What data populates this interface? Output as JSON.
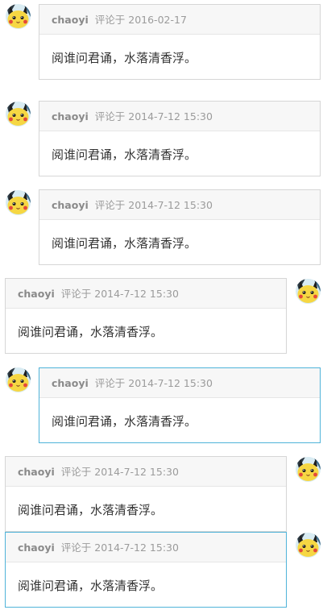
{
  "comments": [
    {
      "author": "chaoyi",
      "verb": "评论于",
      "date": "2016-02-17",
      "text": "阅谁问君诵，水落清香浮。"
    },
    {
      "author": "chaoyi",
      "verb": "评论于",
      "date": "2014-7-12 15:30",
      "text": "阅谁问君诵，水落清香浮。"
    },
    {
      "author": "chaoyi",
      "verb": "评论于",
      "date": "2014-7-12 15:30",
      "text": "阅谁问君诵，水落清香浮。"
    },
    {
      "author": "chaoyi",
      "verb": "评论于",
      "date": "2014-7-12 15:30",
      "text": "阅谁问君诵，水落清香浮。"
    },
    {
      "author": "chaoyi",
      "verb": "评论于",
      "date": "2014-7-12 15:30",
      "text": "阅谁问君诵，水落清香浮。"
    },
    {
      "author": "chaoyi",
      "verb": "评论于",
      "date": "2014-7-12 15:30",
      "text": "阅谁问君诵，水落清香浮。"
    },
    {
      "author": "chaoyi",
      "verb": "评论于",
      "date": "2014-7-12 15:30",
      "text": "阅谁问君诵，水落清香浮。"
    }
  ],
  "colors": {
    "border": "#d6d6d6",
    "active_border": "#4fb3d9",
    "header_bg": "#f7f7f7",
    "meta_text": "#9b9b9b",
    "body_text": "#333333"
  },
  "avatar_icon": "pikachu-avatar-icon"
}
